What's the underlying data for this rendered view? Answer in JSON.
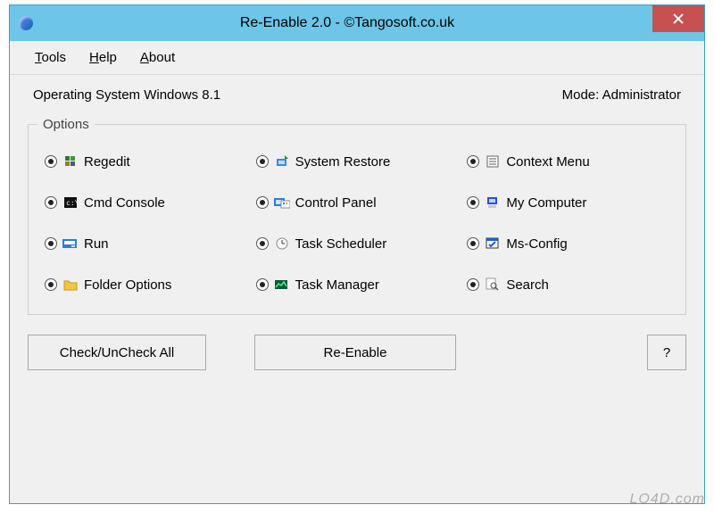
{
  "titlebar": {
    "title": "Re-Enable 2.0  -  ©Tangosoft.co.uk"
  },
  "menu": {
    "tools": "Tools",
    "help": "Help",
    "about": "About"
  },
  "info": {
    "os_label": "Operating System Windows 8.1",
    "mode_label": "Mode: Administrator"
  },
  "options": {
    "legend": "Options",
    "items": [
      {
        "id": "regedit",
        "label": "Regedit",
        "checked": true
      },
      {
        "id": "system-restore",
        "label": "System Restore",
        "checked": true
      },
      {
        "id": "context-menu",
        "label": "Context Menu",
        "checked": true
      },
      {
        "id": "cmd-console",
        "label": "Cmd Console",
        "checked": true
      },
      {
        "id": "control-panel",
        "label": "Control Panel",
        "checked": true
      },
      {
        "id": "my-computer",
        "label": "My Computer",
        "checked": true
      },
      {
        "id": "run",
        "label": "Run",
        "checked": true
      },
      {
        "id": "task-scheduler",
        "label": "Task Scheduler",
        "checked": true
      },
      {
        "id": "ms-config",
        "label": "Ms-Config",
        "checked": true
      },
      {
        "id": "folder-options",
        "label": "Folder Options",
        "checked": true
      },
      {
        "id": "task-manager",
        "label": "Task Manager",
        "checked": true
      },
      {
        "id": "search",
        "label": "Search",
        "checked": true
      }
    ]
  },
  "buttons": {
    "check_all": "Check/UnCheck All",
    "reenable": "Re-Enable",
    "help": "?"
  },
  "watermark": "LO4D.com"
}
